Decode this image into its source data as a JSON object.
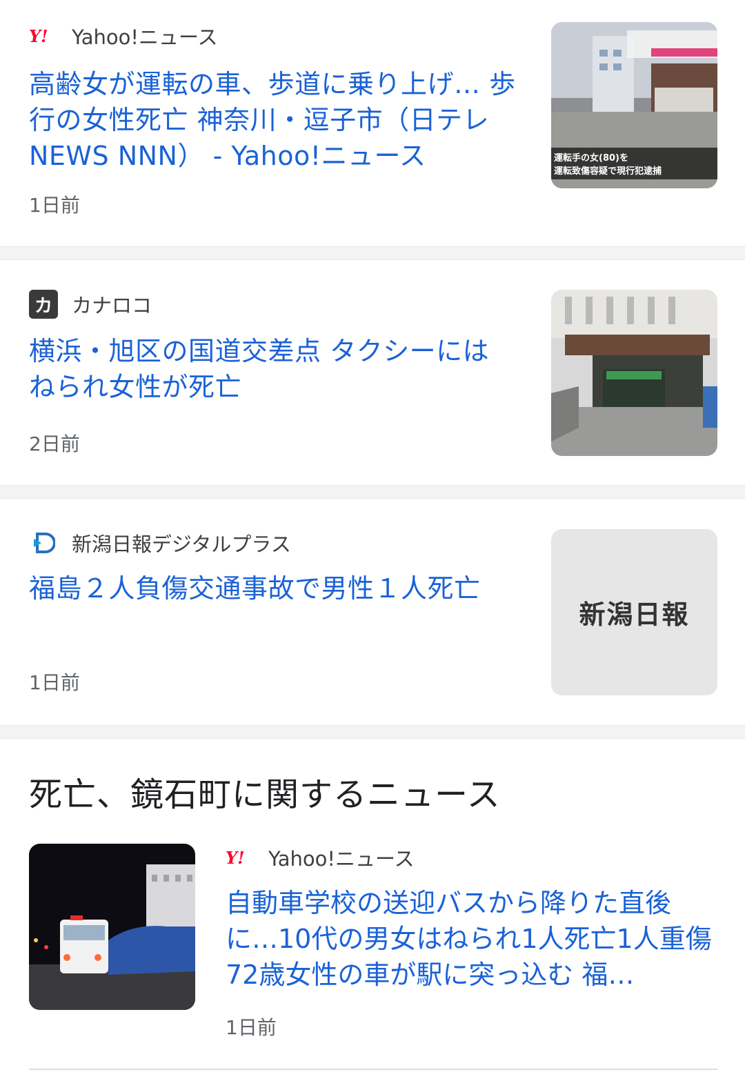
{
  "articles": [
    {
      "source": "Yahoo!ニュース",
      "source_icon": "yahoo-logo-icon",
      "headline": "高齢女が運転の車、歩道に乗り上げ… 歩行の女性死亡 神奈川・逗子市（日テレNEWS NNN） - Yahoo!ニュース",
      "time": "1日前",
      "thumb_caption": "運転手の女(80)を 運転致傷容疑で現行犯逮捕"
    },
    {
      "source": "カナロコ",
      "source_icon": "kanaloco-logo-icon",
      "source_icon_text": "カ",
      "headline": "横浜・旭区の国道交差点 タクシーにはねられ女性が死亡",
      "time": "2日前"
    },
    {
      "source": "新潟日報デジタルプラス",
      "source_icon": "niigata-nippo-logo-icon",
      "headline": "福島２人負傷交通事故で男性１人死亡",
      "time": "1日前",
      "thumb_text": "新潟日報"
    }
  ],
  "section": {
    "title": "死亡、鏡石町に関するニュース",
    "article": {
      "source": "Yahoo!ニュース",
      "source_icon": "yahoo-logo-icon",
      "headline": "自動車学校の送迎バスから降りた直後に…10代の男女はねられ1人死亡1人重傷 72歳女性の車が駅に突っ込む 福…",
      "time": "1日前"
    }
  },
  "colors": {
    "headline": "#1a62d6",
    "source_text": "#3c4043",
    "time_text": "#5f6368",
    "divider": "#f1f3f4",
    "yahoo_red": "#ff0033"
  }
}
